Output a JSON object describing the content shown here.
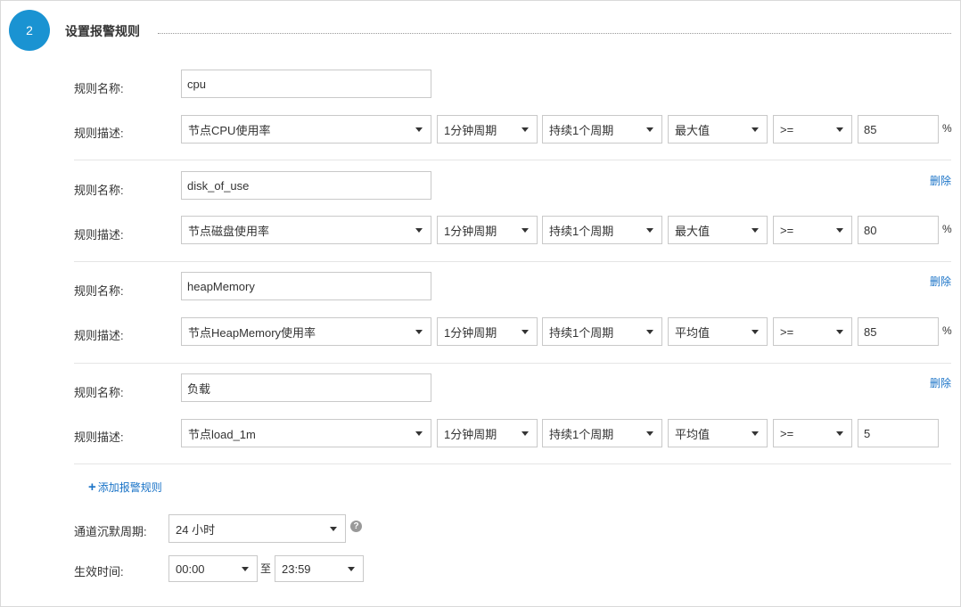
{
  "section": {
    "step_number": "2",
    "title": "设置报警规则"
  },
  "labels": {
    "rule_name": "规则名称:",
    "rule_desc": "规则描述:",
    "delete": "删除",
    "add_rule": "添加报警规则",
    "silence_period": "通道沉默周期:",
    "effective_time": "生效时间:",
    "to": "至",
    "percent": "%"
  },
  "rules": [
    {
      "name": "cpu",
      "metric": "节点CPU使用率",
      "period": "1分钟周期",
      "duration": "持续1个周期",
      "stat": "最大值",
      "operator": ">=",
      "threshold": "85",
      "unit": "%"
    },
    {
      "name": "disk_of_use",
      "metric": "节点磁盘使用率",
      "period": "1分钟周期",
      "duration": "持续1个周期",
      "stat": "最大值",
      "operator": ">=",
      "threshold": "80",
      "unit": "%"
    },
    {
      "name": "heapMemory",
      "metric": "节点HeapMemory使用率",
      "period": "1分钟周期",
      "duration": "持续1个周期",
      "stat": "平均值",
      "operator": ">=",
      "threshold": "85",
      "unit": "%"
    },
    {
      "name": "负载",
      "metric": "节点load_1m",
      "period": "1分钟周期",
      "duration": "持续1个周期",
      "stat": "平均值",
      "operator": ">=",
      "threshold": "5",
      "unit": ""
    }
  ],
  "silence": {
    "value": "24 小时"
  },
  "effective": {
    "start": "00:00",
    "end": "23:59"
  },
  "icons": {
    "help": "question-circle-icon",
    "caret": "chevron-down-icon",
    "plus": "plus-icon"
  },
  "colors": {
    "accent": "#1a93d2",
    "link": "#1a73c7"
  }
}
